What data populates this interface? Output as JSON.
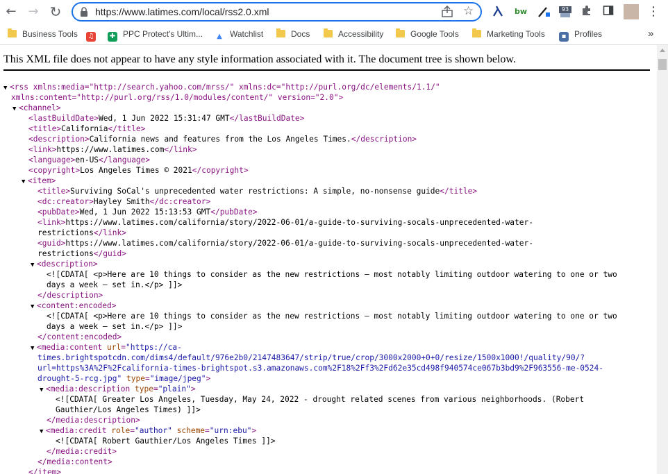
{
  "browser": {
    "url": "https://www.latimes.com/local/rss2.0.xml",
    "back_icon": "←",
    "forward_icon": "→",
    "reload_icon": "↻",
    "star_icon": "☆",
    "menu_icon": "⋮",
    "ext_badge": "93",
    "ext_bw_label": "bw"
  },
  "bookmarks": [
    {
      "label": "Business Tools",
      "kind": "folder"
    },
    {
      "label": "",
      "kind": "app",
      "icon": "music-icon",
      "glyph": "♫",
      "color": "#e94335"
    },
    {
      "label": "PPC Protect's Ultim...",
      "kind": "app",
      "icon": "sheets-icon",
      "glyph": "✚",
      "color": "#0f9d58"
    },
    {
      "label": "Watchlist",
      "kind": "app",
      "icon": "chart-icon",
      "glyph": "▲",
      "color": "#4285f4"
    },
    {
      "label": "Docs",
      "kind": "folder"
    },
    {
      "label": "Accessibility",
      "kind": "folder"
    },
    {
      "label": "Google Tools",
      "kind": "folder"
    },
    {
      "label": "Marketing Tools",
      "kind": "folder"
    },
    {
      "label": "Profiles",
      "kind": "app",
      "icon": "profiles-icon",
      "glyph": "▪",
      "color": "#4a6fa5"
    }
  ],
  "bookmarks_more": "»",
  "notice": "This XML file does not appear to have any style information associated with it. The document tree is shown below.",
  "xml": {
    "rss_open_1": "<rss xmlns:media=\"http://search.yahoo.com/mrss/\" xmlns:dc=\"http://purl.org/dc/elements/1.1/\"",
    "rss_open_2": "xmlns:content=\"http://purl.org/rss/1.0/modules/content/\" version=\"2.0\">",
    "lastBuildDate": "Wed, 1 Jun 2022 15:31:47 GMT",
    "title": "California",
    "description": "California news and features from the Los Angeles Times.",
    "link": "https://www.latimes.com",
    "language": "en-US",
    "copyright": "Los Angeles Times © 2021",
    "item": {
      "title": "Surviving SoCal's unprecedented water restrictions: A simple, no-nonsense guide",
      "creator": "Hayley Smith",
      "pubDate": "Wed, 1 Jun 2022 15:13:53 GMT",
      "link_1": "https://www.latimes.com/california/story/2022-06-01/a-guide-to-surviving-socals-unprecedented-water-",
      "link_2": "restrictions",
      "guid_1": "https://www.latimes.com/california/story/2022-06-01/a-guide-to-surviving-socals-unprecedented-water-",
      "guid_2": "restrictions",
      "desc_cdata_1": "<![CDATA[ <p>Here are 10 things to consider as the new restrictions — most notably limiting outdoor watering to one or two",
      "desc_cdata_2": "days a week — set in.</p> ]]>",
      "content_cdata_1": "<![CDATA[ <p>Here are 10 things to consider as the new restrictions — most notably limiting outdoor watering to one or two",
      "content_cdata_2": "days a week — set in.</p> ]]>",
      "media_url_1": "\"https://ca-",
      "media_url_2": "times.brightspotcdn.com/dims4/default/976e2b0/2147483647/strip/true/crop/3000x2000+0+0/resize/1500x1000!/quality/90/?",
      "media_url_3": "url=https%3A%2F%2Fcalifornia-times-brightspot.s3.amazonaws.com%2F18%2Ff3%2Fd62e35cd498f940574ce067b3bd9%2F963556-me-0524-",
      "media_url_4": "drought-5-rcg.jpg\"",
      "media_type": "\"image/jpeg\"",
      "media_desc_type": "\"plain\"",
      "media_desc_cdata_1": "<![CDATA[ Greater Los Angeles, Tuesday, May 24, 2022 - drought related scenes from various neighborhoods. (Robert",
      "media_desc_cdata_2": "Gauthier/Los Angeles Times) ]]>",
      "credit_role": "\"author\"",
      "credit_scheme": "\"urn:ebu\"",
      "credit_cdata": "<![CDATA[ Robert Gauthier/Los Angeles Times ]]>"
    }
  }
}
